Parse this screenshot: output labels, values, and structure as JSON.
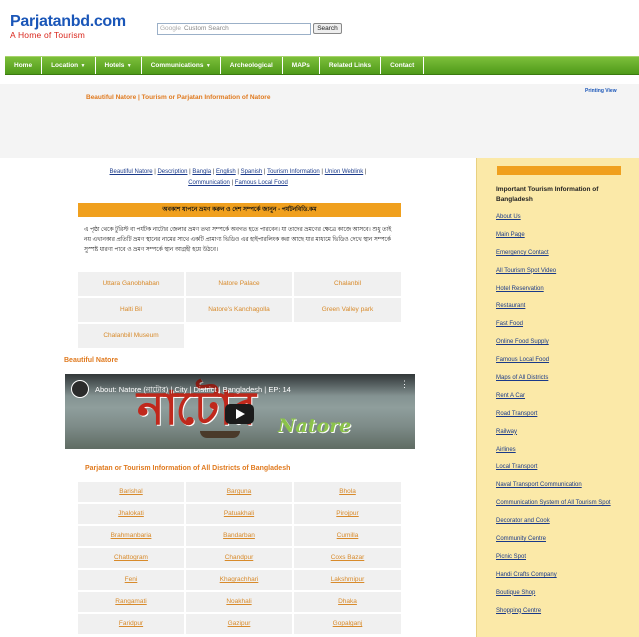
{
  "header": {
    "logo_main": "Parjatanbd.com",
    "logo_sub": "A Home of Tourism",
    "search_brand": "Google",
    "search_placeholder": "Custom Search",
    "search_button": "Search"
  },
  "nav": {
    "items": [
      {
        "label": "Home",
        "caret": false
      },
      {
        "label": "Location",
        "caret": true
      },
      {
        "label": "Hotels",
        "caret": true
      },
      {
        "label": "Communications",
        "caret": true
      },
      {
        "label": "Archeological",
        "caret": false
      },
      {
        "label": "MAPs",
        "caret": false
      },
      {
        "label": "Related Links",
        "caret": false
      },
      {
        "label": "Contact",
        "caret": false
      }
    ]
  },
  "printing_view": "Printing View",
  "page_heading": "Beautiful Natore | Tourism or Parjatan Information of Natore",
  "links_row": {
    "items": [
      "Beautiful Natore",
      "Description",
      "Bangla",
      "English",
      "Spanish",
      "Tourism Information",
      "Union Weblink",
      "Communication",
      "Famous Local Food"
    ]
  },
  "title_bar": "অবকাশ যাপনে ভ্রমণ করুন ও দেশ সম্পর্কে জানুন - পর্যটনবিডি.কম",
  "intro": "এ পৃষ্ঠা থেকে টুরিস্ট বা পর্যটক নাটোর জেলার ভ্রমণ তথ্য সম্পর্কে অবগত হতে পারবেন। যা তাদের ভ্রমণের ক্ষেত্রে কাজে আসবে। শুধু তাই নয় এখানকার প্রতিটি ভ্রমণ স্থানের নামের সাথে একটি প্রামাণ্য ভিডিও এর হাইপারলিংক করা আছে যার মাধ্যমে ভিডিও দেখে স্থান সম্পর্কে সুস্পষ্ট ধারণা পাবে ও ভ্রমণ সম্পর্কে স্থান আগ্রহী হয়ে উঠবে।",
  "spots": [
    "Uttara Ganobhaban",
    "Natore Palace",
    "Chalanbil",
    "Halti Bil",
    "Natore's Kanchagolla",
    "Green Valley park",
    "Chalanbill Museum"
  ],
  "section_label": "Beautiful Natore",
  "video": {
    "title": "About: Natore (নাটোর) | City | District | Bangladesh | EP: 14",
    "big_text": "নাটোর",
    "sub_text": "Natore"
  },
  "districts_label": "Parjatan or Tourism Information of All Districts of Bangladesh",
  "districts": [
    "Barishal",
    "Barguna",
    "Bhola",
    "Jhalokati",
    "Patuakhali",
    "Pirojpur",
    "Brahmanbaria",
    "Bandarban",
    "Cumilla",
    "Chattogram",
    "Chandpur",
    "Coxs Bazar",
    "Feni",
    "Khagrachhari",
    "Lakshmipur",
    "Rangamati",
    "Noakhali",
    "Dhaka",
    "Faridpur",
    "Gazipur",
    "Gopalganj"
  ],
  "sidebar": {
    "title": "Important Tourism Information of Bangladesh",
    "items": [
      "About Us",
      "Main Page",
      "Emergency Contact",
      "All Tourism Spot Video",
      "Hotel Reservation",
      "Restaurant",
      "Fast Food",
      "Online Food Supply",
      "Famous Local Food",
      "Maps of All Districts",
      "Rent A Car",
      "Road Transport",
      "Railway",
      "Airlines",
      "Local Transport",
      "Naval Transport Communication",
      "Communication System of All Tourism Spot",
      "Decorator and Cook",
      "Community Centre",
      "Picnic Spot",
      "Handi Crafts Company",
      "Boutique Shop",
      "Shopping Centre"
    ]
  }
}
